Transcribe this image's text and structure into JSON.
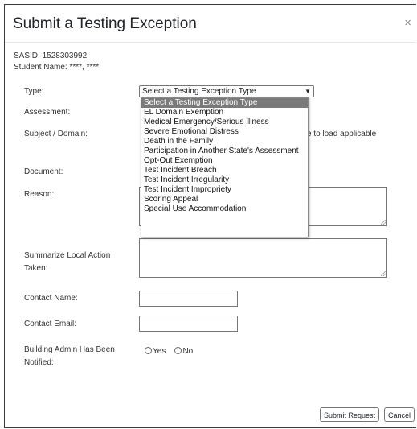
{
  "modal": {
    "title": "Submit a Testing Exception",
    "close_label": "×"
  },
  "student": {
    "sasid": "SASID: 1528303992",
    "name": "Student Name: ****, ****"
  },
  "form": {
    "type_label": "Type:",
    "assessment_label": "Assessment:",
    "subject_label": "Subject / Domain:",
    "document_label": "Document:",
    "reason_label": "Reason:",
    "summarize_label": "Summarize Local Action Taken:",
    "contact_name_label": "Contact Name:",
    "contact_email_label": "Contact Email:",
    "building_admin_label": "Building Admin Has Been Notified:",
    "subject_hint_partial": "e to load applicable",
    "type_selected": "Select a Testing Exception Type",
    "radio_yes": "Yes",
    "radio_no": "No"
  },
  "dropdown_options": [
    "Select a Testing Exception Type",
    "EL Domain Exemption",
    "Medical Emergency/Serious Illness",
    "Severe Emotional Distress",
    "Death in the Family",
    "Participation in Another State's Assessment",
    "Opt-Out Exemption",
    "Test Incident Breach",
    "Test Incident Irregularity",
    "Test Incident Impropriety",
    "Scoring Appeal",
    "Special Use Accommodation"
  ],
  "footer": {
    "submit_label": "Submit Request",
    "cancel_label": "Cancel"
  }
}
